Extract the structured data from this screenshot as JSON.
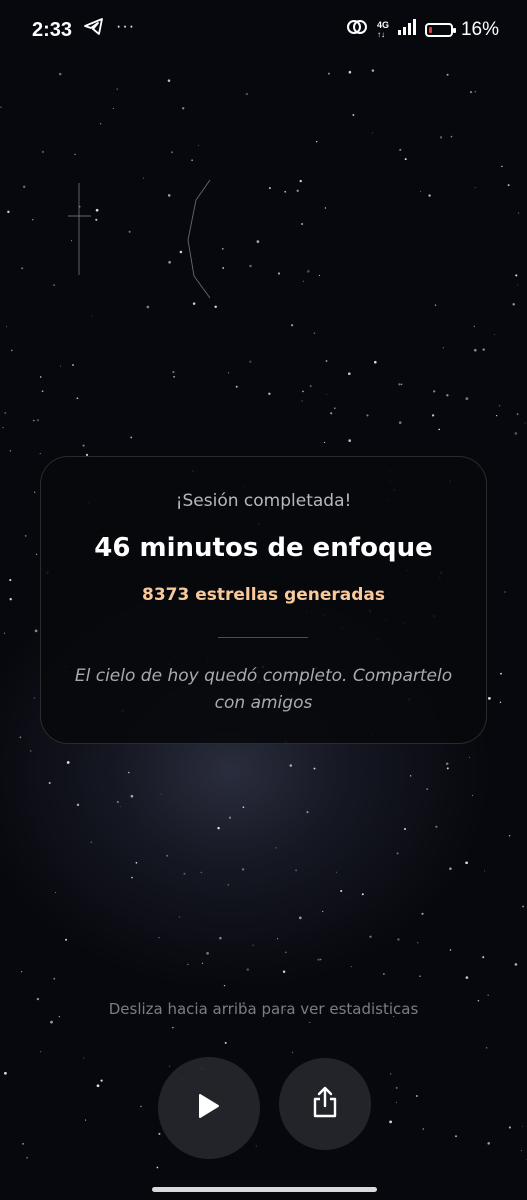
{
  "status_bar": {
    "time": "2:33",
    "overflow_dots": "···",
    "network": "4G",
    "battery_text": "16%",
    "battery_level": 0.16
  },
  "summary_card": {
    "kicker": "¡Sesión completada!",
    "title": "46 minutos de enfoque",
    "stars_generated": "8373 estrellas generadas",
    "message": "El cielo de hoy quedó completo. Compartelo con amigos"
  },
  "swipe_hint": "Desliza hacia arriba para ver estadisticas",
  "controls": {
    "play_icon": "play-icon",
    "share_icon": "share-icon"
  },
  "colors": {
    "accent": "#f8c99a",
    "battery_low": "#e53935",
    "background": "#06070b"
  }
}
